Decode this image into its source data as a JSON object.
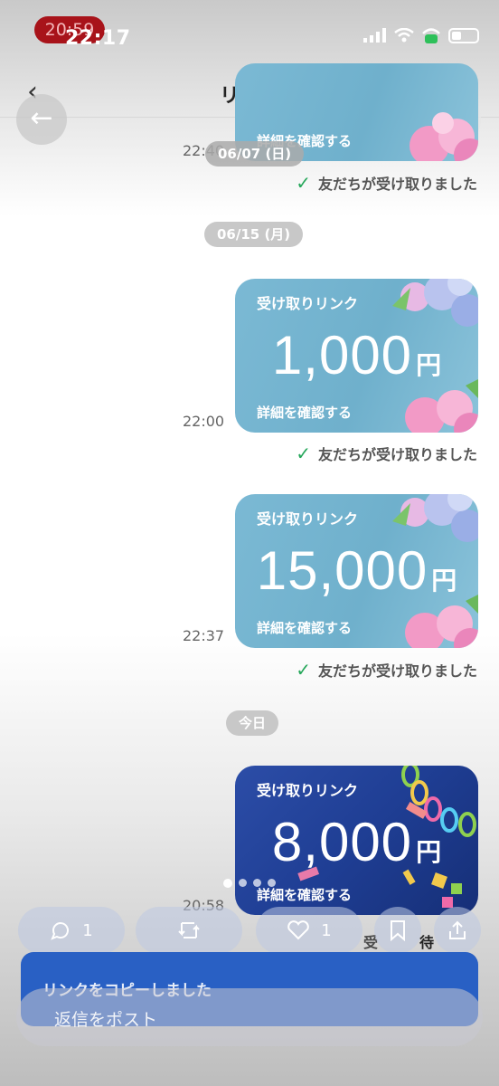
{
  "status_bar": {
    "recording_time": "20:59",
    "clock": "22:17"
  },
  "nav": {
    "back_glyph": "‹",
    "title": "リンク",
    "help_glyph": "?"
  },
  "overlay": {
    "back_glyph": "←",
    "more_glyph": "•••"
  },
  "chat": {
    "received_text": "友だちが受け取りました",
    "top_partial": {
      "detail": "詳細を確認する",
      "time": "22:40",
      "date_pill": "06/07 (日)"
    },
    "date_pill_2": "06/15 (月)",
    "date_pill_today": "今日",
    "cards": [
      {
        "label": "受け取りリンク",
        "amount": "1,000",
        "currency": "円",
        "detail": "詳細を確認する",
        "time": "22:00"
      },
      {
        "label": "受け取りリンク",
        "amount": "15,000",
        "currency": "円",
        "detail": "詳細を確認する",
        "time": "22:37"
      },
      {
        "label": "受け取りリンク",
        "amount": "8,000",
        "currency": "円",
        "detail": "詳細を確認する",
        "time": "20:58"
      }
    ],
    "partial_status": "受",
    "partial_status_2": "待"
  },
  "actions": {
    "comment_count": "1",
    "like_count": "1"
  },
  "toast": {
    "text": "リンクをコピーしました"
  },
  "reply": {
    "placeholder": "返信をポスト"
  },
  "colors": {
    "card_blue": "#7bb9d4",
    "card_navy": "#1f3e94",
    "toast_blue": "#2960c4",
    "check_green": "#25a75a"
  }
}
